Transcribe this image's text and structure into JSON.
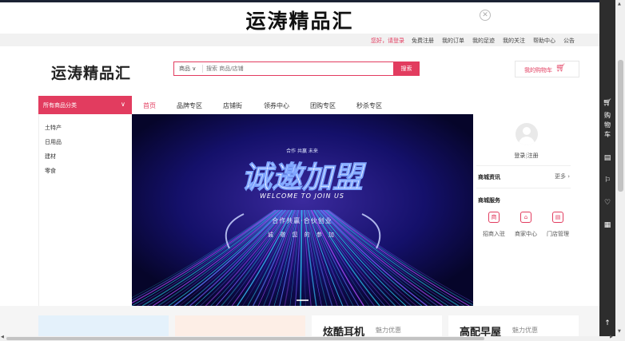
{
  "popup": {
    "title": "运涛精品汇",
    "close_icon": "close-icon"
  },
  "topbar": {
    "greeting": "您好，请登录",
    "links": [
      "免费注册",
      "我的订单",
      "我的足迹",
      "我的关注",
      "帮助中心",
      "公告"
    ]
  },
  "header": {
    "logo": "运涛精品汇",
    "search": {
      "category": "商品",
      "placeholder": "搜索 商品/店铺",
      "button": "搜索"
    },
    "cart_button": "我的购物车"
  },
  "nav": {
    "category_head": "所有商品分类",
    "items": [
      "首页",
      "品牌专区",
      "店铺街",
      "领券中心",
      "团购专区",
      "秒杀专区"
    ],
    "active_index": 0
  },
  "categories": [
    "土特产",
    "日用品",
    "建材",
    "零食"
  ],
  "banner": {
    "top_small": "合作 共赢 未来",
    "main": "诚邀加盟",
    "english": "WELCOME TO JOIN US",
    "line1": "合作共赢·合伙创业",
    "line2": "诚 邀 您 的 参 加",
    "slide_count": 1,
    "active_slide": 0
  },
  "side_panel": {
    "login": "登录",
    "divider": "|",
    "register": "注册",
    "news_title": "商城资讯",
    "more": "更多",
    "service_title": "商城服务",
    "services": [
      {
        "label": "招商入驻",
        "icon": "shop-icon",
        "glyph": "商"
      },
      {
        "label": "商家中心",
        "icon": "home-icon",
        "glyph": "⌂"
      },
      {
        "label": "门店管理",
        "icon": "store-icon",
        "glyph": "▤"
      }
    ]
  },
  "promo_cards": [
    {
      "title": "",
      "subtitle": ""
    },
    {
      "title": "",
      "subtitle": ""
    },
    {
      "title": "炫酷耳机",
      "subtitle": "魅力优惠"
    },
    {
      "title": "高配早屋",
      "subtitle": "魅力优惠"
    }
  ],
  "right_toolbar": {
    "cart_text": "购物车",
    "icons": [
      "cart-icon",
      "calendar-icon",
      "coupon-icon",
      "heart-icon",
      "grid-icon",
      "back-to-top-icon"
    ]
  },
  "colors": {
    "accent": "#e23c5f",
    "toolbar": "#2d2d2d",
    "banner_bg": "#0a0835"
  }
}
